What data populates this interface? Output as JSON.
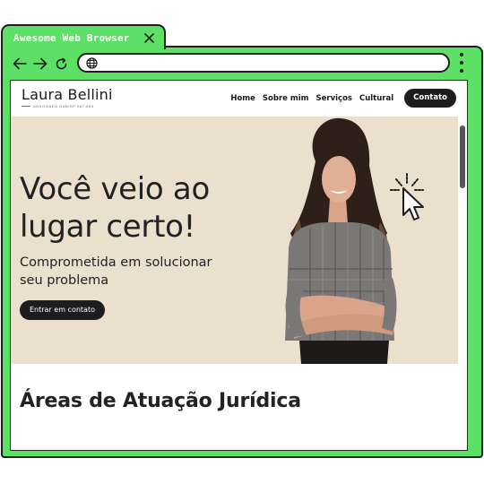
{
  "browser": {
    "tab_title": "Awesome Web Browser",
    "url": "",
    "accent": "#5de066"
  },
  "site": {
    "logo_name": "Laura Bellini",
    "logo_tagline": "ADVOGADA OAB/SP 987.654",
    "nav": [
      {
        "label": "Home"
      },
      {
        "label": "Sobre mim"
      },
      {
        "label": "Serviços"
      },
      {
        "label": "Cultural"
      }
    ],
    "contact_label": "Contato"
  },
  "hero": {
    "title": "Você veio ao lugar certo!",
    "subtitle": "Comprometida em solucionar seu problema",
    "cta_label": "Entrar em contato",
    "bg_color": "#ebdfce"
  },
  "section": {
    "title": "Áreas de Atuação Jurídica"
  }
}
